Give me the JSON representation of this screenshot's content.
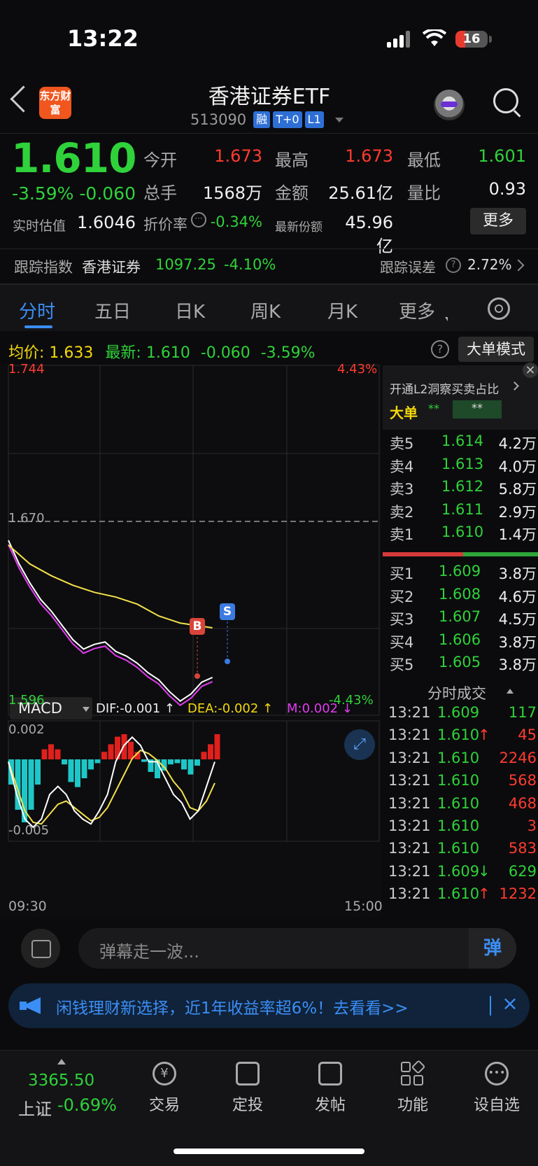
{
  "status": {
    "time": "13:22",
    "battery": "16"
  },
  "header": {
    "logo": "东方财富",
    "title": "香港证券ETF",
    "code": "513090",
    "tags": [
      "融",
      "T+0",
      "L1"
    ]
  },
  "quote": {
    "price": "1.610",
    "change_pct": "-3.59%",
    "change": "-0.060",
    "open_label": "今开",
    "open": "1.673",
    "high_label": "最高",
    "high": "1.673",
    "low_label": "最低",
    "low": "1.601",
    "volume_label": "总手",
    "volume": "1568万",
    "amount_label": "金额",
    "amount": "25.61亿",
    "ratio_label": "量比",
    "ratio": "0.93",
    "iopv_label": "实时估值",
    "iopv": "1.6046",
    "premium_label": "折价率",
    "premium": "-0.34%",
    "shares_label": "最新份额",
    "shares": "45.96亿",
    "more": "更多"
  },
  "track": {
    "label": "跟踪指数",
    "index_name": "香港证券",
    "index_value": "1097.25",
    "index_chg": "-4.10%",
    "error_label": "跟踪误差",
    "error_value": "2.72%"
  },
  "tabs": [
    "分时",
    "五日",
    "日K",
    "周K",
    "月K",
    "更多"
  ],
  "avg_line": {
    "avg_label": "均价:",
    "avg": "1.633",
    "latest_label": "最新:",
    "latest": "1.610",
    "chg": "-0.060",
    "pct": "-3.59%",
    "mode_btn": "大单模式"
  },
  "chart": {
    "y_top": "1.744",
    "y_top_pct": "4.43%",
    "y_mid": "1.670",
    "y_bottom": "1.596",
    "y_bottom_pct": "-4.43%",
    "x_start": "09:30",
    "x_end": "15:00",
    "buy_marker": "B",
    "sell_marker": "S",
    "macd_name": "MACD",
    "dif": "DIF:-0.001 ↑",
    "dea": "DEA:-0.002 ↑",
    "m": "M:0.002 ↓",
    "macd_top": "0.002",
    "macd_bottom": "-0.005"
  },
  "chart_data": {
    "type": "line",
    "x_range": [
      "09:30",
      "15:00"
    ],
    "ylim": [
      1.596,
      1.744
    ],
    "prev_close": 1.67,
    "series": [
      {
        "name": "price",
        "points": [
          [
            0,
            1.67
          ],
          [
            5,
            1.66
          ],
          [
            10,
            1.652
          ],
          [
            15,
            1.645
          ],
          [
            20,
            1.64
          ],
          [
            25,
            1.634
          ],
          [
            30,
            1.628
          ],
          [
            35,
            1.624
          ],
          [
            40,
            1.626
          ],
          [
            45,
            1.627
          ],
          [
            50,
            1.623
          ],
          [
            55,
            1.621
          ],
          [
            60,
            1.618
          ],
          [
            65,
            1.614
          ],
          [
            70,
            1.611
          ],
          [
            75,
            1.606
          ],
          [
            80,
            1.602
          ],
          [
            85,
            1.605
          ],
          [
            90,
            1.61
          ],
          [
            95,
            1.612
          ]
        ]
      },
      {
        "name": "avg",
        "points": [
          [
            0,
            1.668
          ],
          [
            10,
            1.66
          ],
          [
            20,
            1.655
          ],
          [
            30,
            1.651
          ],
          [
            40,
            1.648
          ],
          [
            50,
            1.646
          ],
          [
            60,
            1.643
          ],
          [
            70,
            1.638
          ],
          [
            80,
            1.635
          ],
          [
            95,
            1.633
          ]
        ]
      }
    ],
    "macd": {
      "hist": [
        -0.002,
        -0.004,
        -0.005,
        -0.004,
        -0.002,
        0.0008,
        0.0012,
        0.0008,
        -0.0004,
        -0.0018,
        -0.0022,
        -0.0015,
        -0.0008,
        -0.0003,
        0.0006,
        0.0012,
        0.0018,
        0.002,
        0.0014,
        0.0006,
        -0.0002,
        -0.001,
        -0.0015,
        -0.0009,
        -0.0004,
        -0.0003,
        -0.0008,
        -0.0012,
        -0.0005,
        0.0006,
        0.0012,
        0.002
      ],
      "dif": [
        -0.001,
        -0.003,
        -0.0045,
        -0.005,
        -0.0045,
        -0.003,
        -0.0025,
        -0.003,
        -0.004,
        -0.0045,
        -0.0048,
        -0.004,
        -0.003,
        -0.001,
        0,
        0.0005,
        0,
        -0.001,
        -0.001,
        -0.002,
        -0.003,
        -0.0035,
        -0.0045,
        -0.004,
        -0.0025,
        -0.001
      ],
      "dea": [
        -0.001,
        -0.0025,
        -0.004,
        -0.0047,
        -0.0048,
        -0.0042,
        -0.0036,
        -0.0034,
        -0.0038,
        -0.0042,
        -0.0046,
        -0.0044,
        -0.0038,
        -0.0028,
        -0.0018,
        -0.0008,
        -0.0003,
        -0.0005,
        -0.0009,
        -0.0014,
        -0.0022,
        -0.0028,
        -0.0038,
        -0.004,
        -0.0034,
        -0.0023
      ]
    }
  },
  "book": {
    "promo": "开通L2洞察买卖占比",
    "big_label": "大单",
    "big_val1": "**",
    "big_val2": "**",
    "asks": [
      {
        "label": "卖5",
        "price": "1.614",
        "vol": "4.2万"
      },
      {
        "label": "卖4",
        "price": "1.613",
        "vol": "4.0万"
      },
      {
        "label": "卖3",
        "price": "1.612",
        "vol": "5.8万"
      },
      {
        "label": "卖2",
        "price": "1.611",
        "vol": "2.9万"
      },
      {
        "label": "卖1",
        "price": "1.610",
        "vol": "1.4万"
      }
    ],
    "bids": [
      {
        "label": "买1",
        "price": "1.609",
        "vol": "3.8万"
      },
      {
        "label": "买2",
        "price": "1.608",
        "vol": "4.6万"
      },
      {
        "label": "买3",
        "price": "1.607",
        "vol": "4.5万"
      },
      {
        "label": "买4",
        "price": "1.606",
        "vol": "3.8万"
      },
      {
        "label": "买5",
        "price": "1.605",
        "vol": "3.8万"
      }
    ],
    "trades_title": "分时成交",
    "trades": [
      {
        "t": "13:21",
        "p": "1.609",
        "v": "117",
        "arrow": ""
      },
      {
        "t": "13:21",
        "p": "1.610",
        "v": "45",
        "arrow": "↑"
      },
      {
        "t": "13:21",
        "p": "1.610",
        "v": "2246",
        "arrow": ""
      },
      {
        "t": "13:21",
        "p": "1.610",
        "v": "568",
        "arrow": ""
      },
      {
        "t": "13:21",
        "p": "1.610",
        "v": "468",
        "arrow": ""
      },
      {
        "t": "13:21",
        "p": "1.610",
        "v": "3",
        "arrow": ""
      },
      {
        "t": "13:21",
        "p": "1.610",
        "v": "583",
        "arrow": ""
      },
      {
        "t": "13:21",
        "p": "1.609",
        "v": "629",
        "arrow": "↓"
      },
      {
        "t": "13:21",
        "p": "1.610",
        "v": "1232",
        "arrow": "↑"
      }
    ]
  },
  "danmu": {
    "placeholder": "弹幕走一波...",
    "send": "弹"
  },
  "banner": {
    "text": "闲钱理财新选择，近1年收益率超6%！去看看>>"
  },
  "bottom_nav": {
    "index_value": "3365.50",
    "index_name": "上证",
    "index_chg": "-0.69%",
    "items": [
      "交易",
      "定投",
      "发帖",
      "功能",
      "设自选"
    ]
  }
}
